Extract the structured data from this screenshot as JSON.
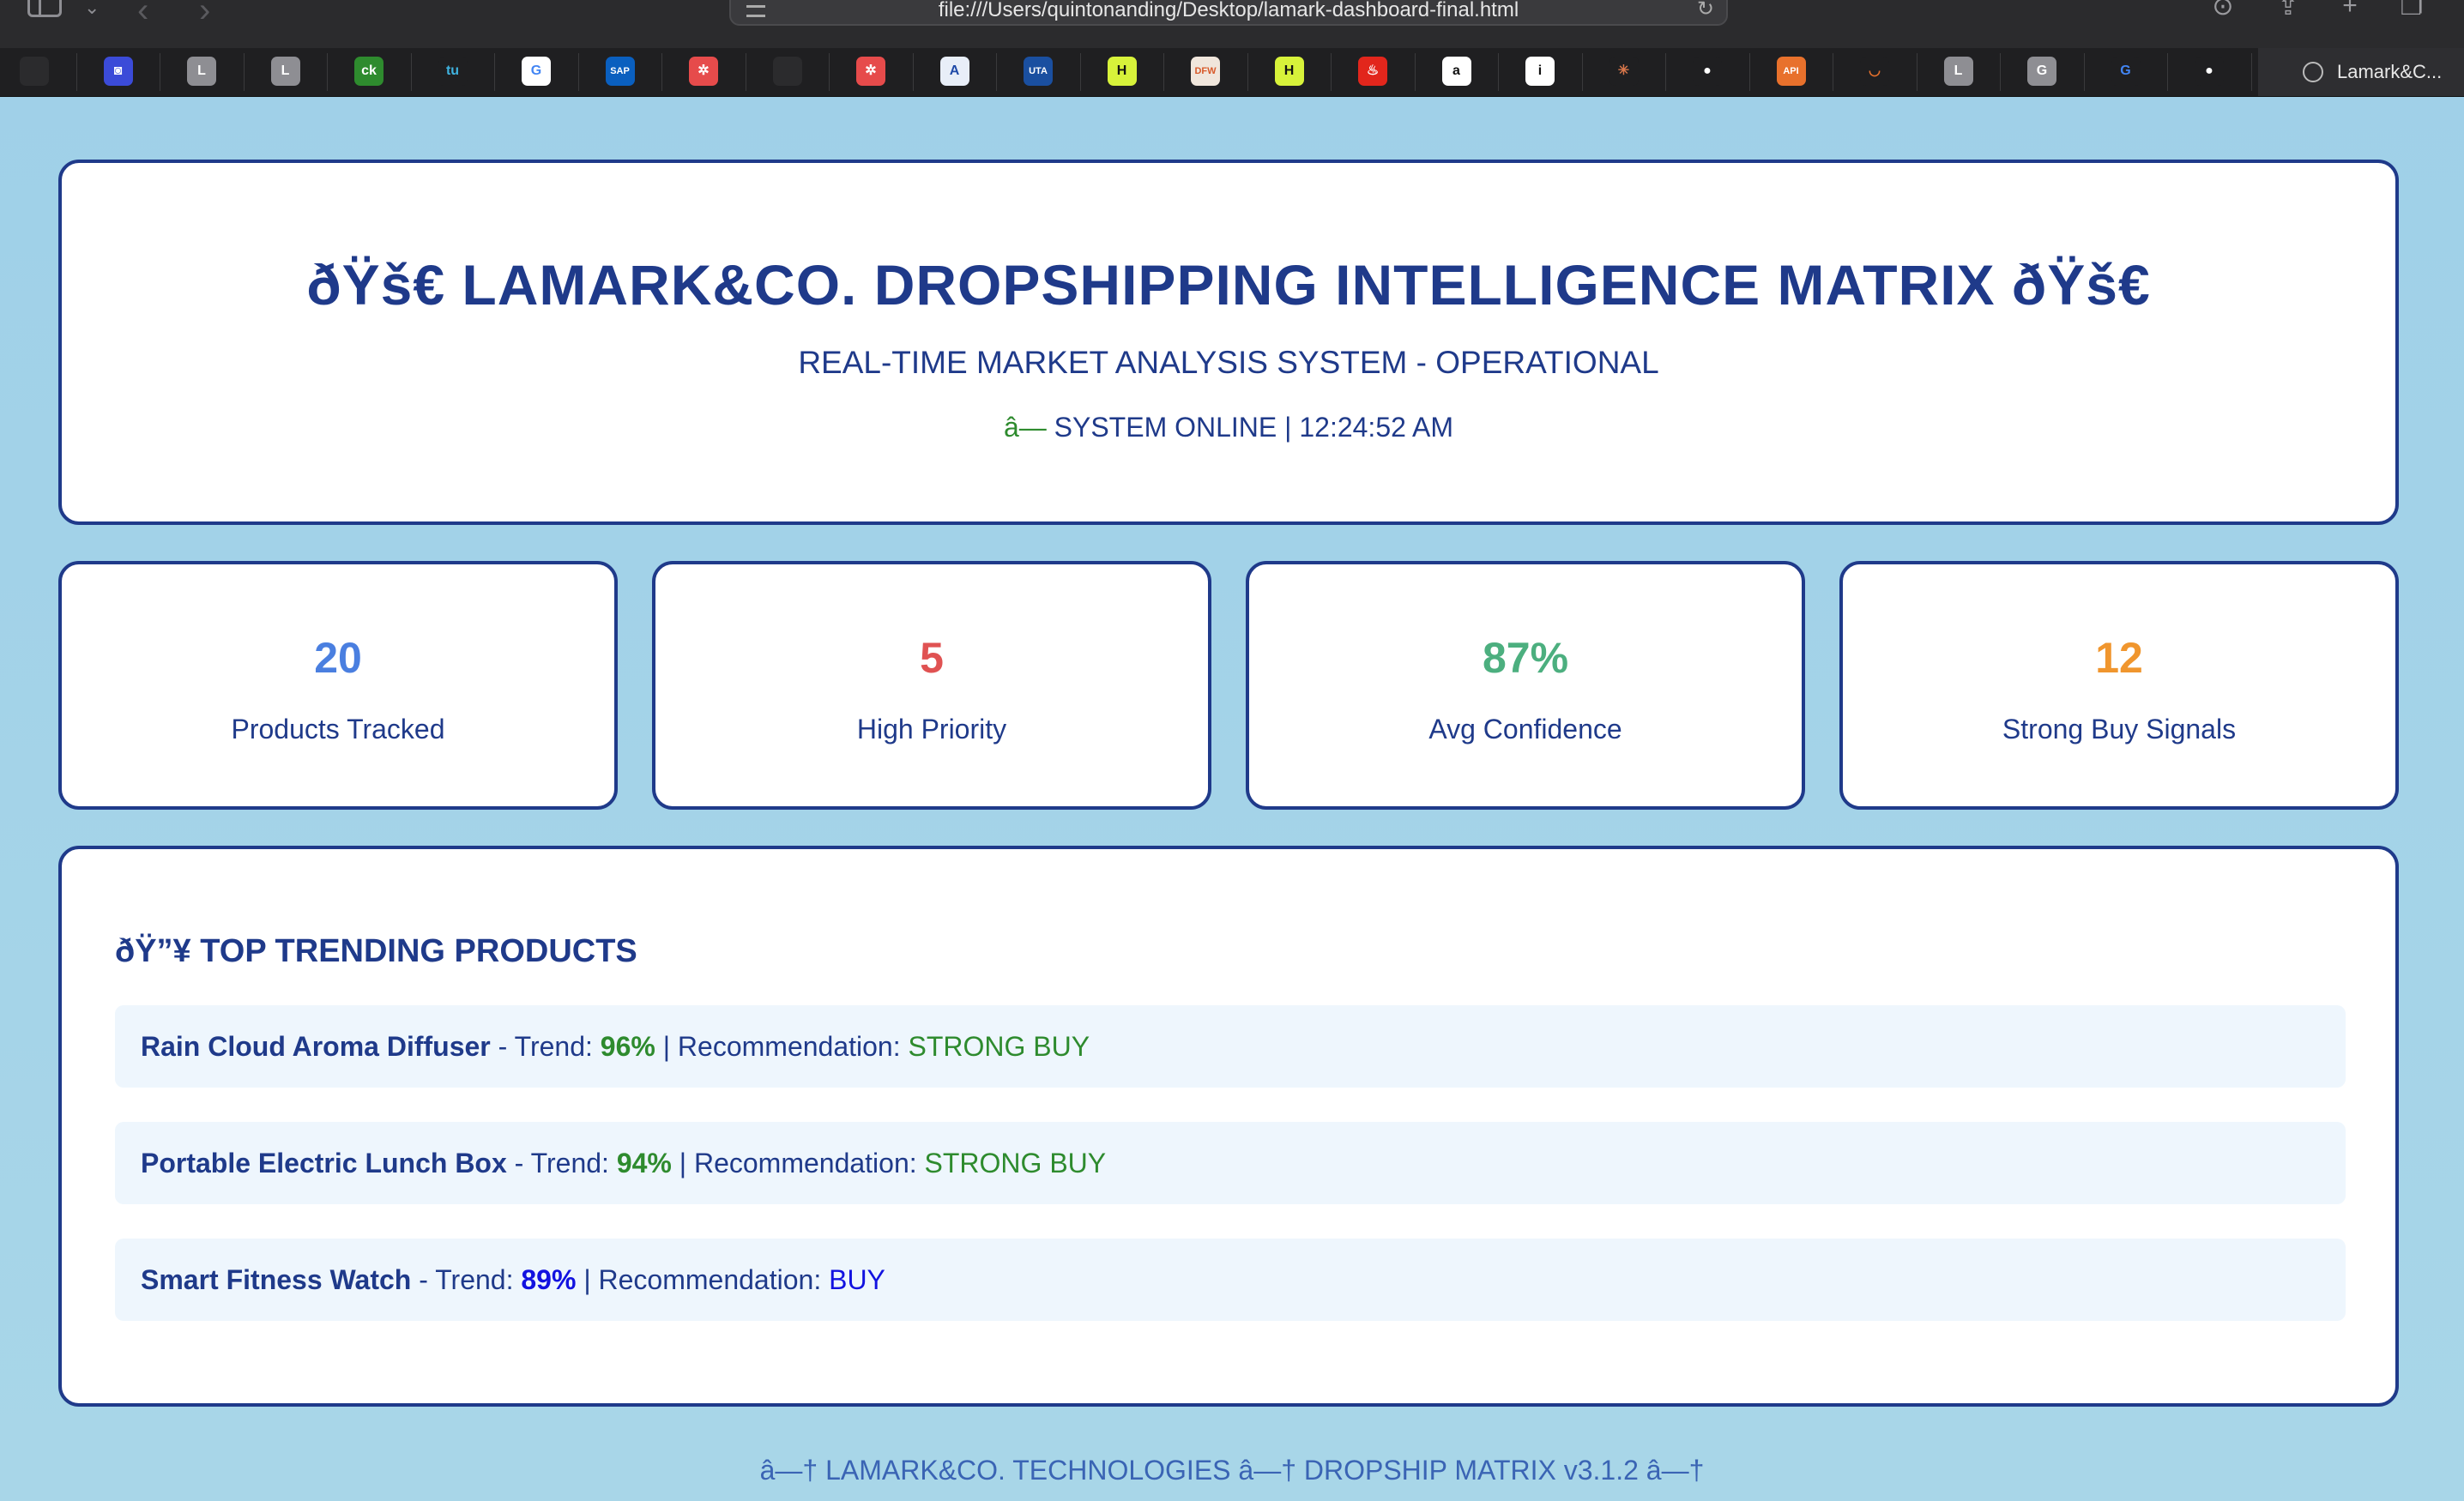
{
  "browser": {
    "url": "file:///Users/quintonanding/Desktop/lamark-dashboard-final.html",
    "active_tab_title": "Lamark&C..."
  },
  "favicons": [
    {
      "name": "fish-favicon",
      "label": "",
      "bg": "#2b2b2d",
      "color": "#8fa8c8"
    },
    {
      "name": "square-favicon",
      "label": "◙",
      "bg": "#3b4bd8",
      "color": "#ffffff"
    },
    {
      "name": "letter-l-favicon",
      "label": "L",
      "bg": "#8e8e93",
      "color": "#ffffff"
    },
    {
      "name": "letter-l-favicon",
      "label": "L",
      "bg": "#8e8e93",
      "color": "#ffffff"
    },
    {
      "name": "ck-favicon",
      "label": "ck",
      "bg": "#2e8b2e",
      "color": "#ffffff"
    },
    {
      "name": "tu-favicon",
      "label": "tu",
      "bg": "#1f1f21",
      "color": "#3fb3e0"
    },
    {
      "name": "google-favicon",
      "label": "G",
      "bg": "#ffffff",
      "color": "#4285f4"
    },
    {
      "name": "sap-favicon",
      "label": "SAP",
      "bg": "#0a5fbf",
      "color": "#ffffff"
    },
    {
      "name": "red-grid-favicon",
      "label": "✲",
      "bg": "#e64b4b",
      "color": "#ffffff"
    },
    {
      "name": "fish-favicon",
      "label": "",
      "bg": "#2b2b2d",
      "color": "#8fa8c8"
    },
    {
      "name": "red-grid-favicon",
      "label": "✲",
      "bg": "#e64b4b",
      "color": "#ffffff"
    },
    {
      "name": "a-favicon",
      "label": "A",
      "bg": "#e8eef8",
      "color": "#1f4aa8"
    },
    {
      "name": "uta-favicon",
      "label": "UTA",
      "bg": "#1a4fa0",
      "color": "#ffffff"
    },
    {
      "name": "h-favicon",
      "label": "H",
      "bg": "#d7f23a",
      "color": "#111111"
    },
    {
      "name": "dfw-favicon",
      "label": "DFW",
      "bg": "#f0e6dc",
      "color": "#d85a2a"
    },
    {
      "name": "h-favicon",
      "label": "H",
      "bg": "#d7f23a",
      "color": "#111111"
    },
    {
      "name": "santander-favicon",
      "label": "♨",
      "bg": "#e2261c",
      "color": "#ffffff"
    },
    {
      "name": "amazon-favicon",
      "label": "a",
      "bg": "#ffffff",
      "color": "#111111"
    },
    {
      "name": "info-favicon",
      "label": "i",
      "bg": "#ffffff",
      "color": "#111111"
    },
    {
      "name": "claude-favicon",
      "label": "✳",
      "bg": "#1f1f21",
      "color": "#d9774b"
    },
    {
      "name": "github-favicon",
      "label": "●",
      "bg": "#1f1f21",
      "color": "#ffffff"
    },
    {
      "name": "api-favicon",
      "label": "API",
      "bg": "#e8712c",
      "color": "#ffffff"
    },
    {
      "name": "orange-arc-favicon",
      "label": "◡",
      "bg": "#1f1f21",
      "color": "#e8712c"
    },
    {
      "name": "letter-l-favicon",
      "label": "L",
      "bg": "#8e8e93",
      "color": "#ffffff"
    },
    {
      "name": "letter-g-favicon",
      "label": "G",
      "bg": "#8e8e93",
      "color": "#ffffff"
    },
    {
      "name": "google-favicon",
      "label": "G",
      "bg": "#1f1f21",
      "color": "#4285f4"
    },
    {
      "name": "github-favicon",
      "label": "●",
      "bg": "#1f1f21",
      "color": "#ffffff"
    }
  ],
  "header": {
    "title": "ðŸš€ LAMARK&CO. DROPSHIPPING INTELLIGENCE MATRIX ðŸš€",
    "subtitle": "REAL-TIME MARKET ANALYSIS SYSTEM - OPERATIONAL",
    "status_dot": "â—",
    "status_text": "SYSTEM ONLINE | 12:24:52 AM"
  },
  "stats": [
    {
      "value": "20",
      "label": "Products Tracked",
      "color": "#4a7fe0"
    },
    {
      "value": "5",
      "label": "High Priority",
      "color": "#e05252"
    },
    {
      "value": "87%",
      "label": "Avg Confidence",
      "color": "#4caf7f"
    },
    {
      "value": "12",
      "label": "Strong Buy Signals",
      "color": "#f0962e"
    }
  ],
  "trending": {
    "title": "ðŸ”¥ TOP TRENDING PRODUCTS",
    "trend_label": "Trend:",
    "rec_label": "Recommendation:",
    "items": [
      {
        "name": "Rain Cloud Aroma Diffuser",
        "trend": "96%",
        "recommendation": "STRONG BUY",
        "color": "#2e8b2e"
      },
      {
        "name": "Portable Electric Lunch Box",
        "trend": "94%",
        "recommendation": "STRONG BUY",
        "color": "#2e8b2e"
      },
      {
        "name": "Smart Fitness Watch",
        "trend": "89%",
        "recommendation": "BUY",
        "color": "#1212e0"
      }
    ]
  },
  "footer": "â—† LAMARK&CO. TECHNOLOGIES â—† DROPSHIP MATRIX v3.1.2 â—†"
}
